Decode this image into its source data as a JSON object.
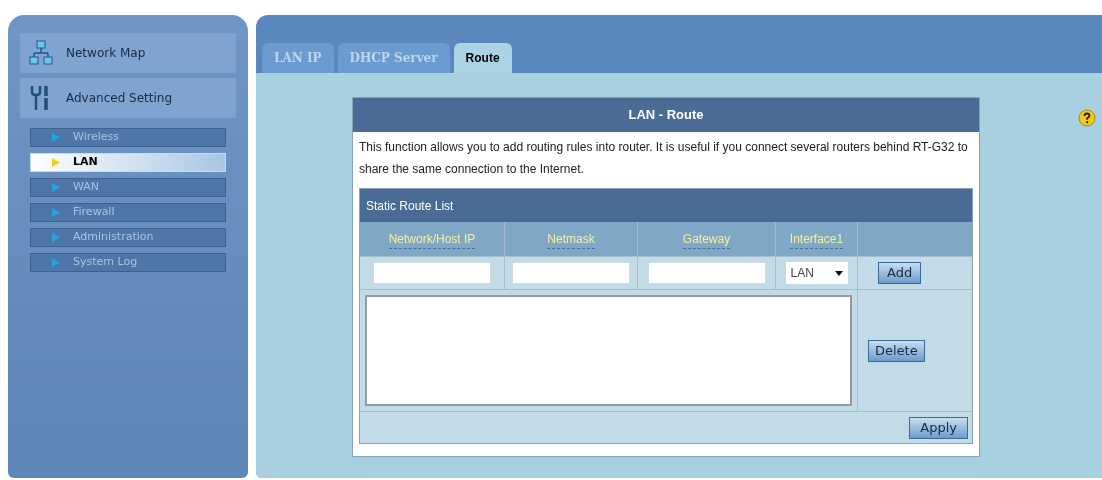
{
  "sidebar": {
    "sections": [
      {
        "kind": "map",
        "label": "Network Map"
      },
      {
        "kind": "tools",
        "label": "Advanced Setting"
      }
    ],
    "items": [
      {
        "label": "Wireless",
        "selected": false
      },
      {
        "label": "LAN",
        "selected": true
      },
      {
        "label": "WAN",
        "selected": false
      },
      {
        "label": "Firewall",
        "selected": false
      },
      {
        "label": "Administration",
        "selected": false
      },
      {
        "label": "System Log",
        "selected": false
      }
    ]
  },
  "tabs": [
    {
      "label": "LAN IP",
      "selected": false
    },
    {
      "label": "DHCP Server",
      "selected": false
    },
    {
      "label": "Route",
      "selected": true
    }
  ],
  "card": {
    "title": "LAN - Route",
    "description": "This function allows you to add routing rules into router. It is useful if you connect several routers behind RT-G32 to share the same connection to the Internet.",
    "list_title": "Static Route List",
    "columns": [
      "Network/Host IP",
      "Netmask",
      "Gateway",
      "Interface1"
    ],
    "interface": "LAN",
    "add_button": "Add",
    "delete_button": "Delete",
    "apply_button": "Apply"
  }
}
